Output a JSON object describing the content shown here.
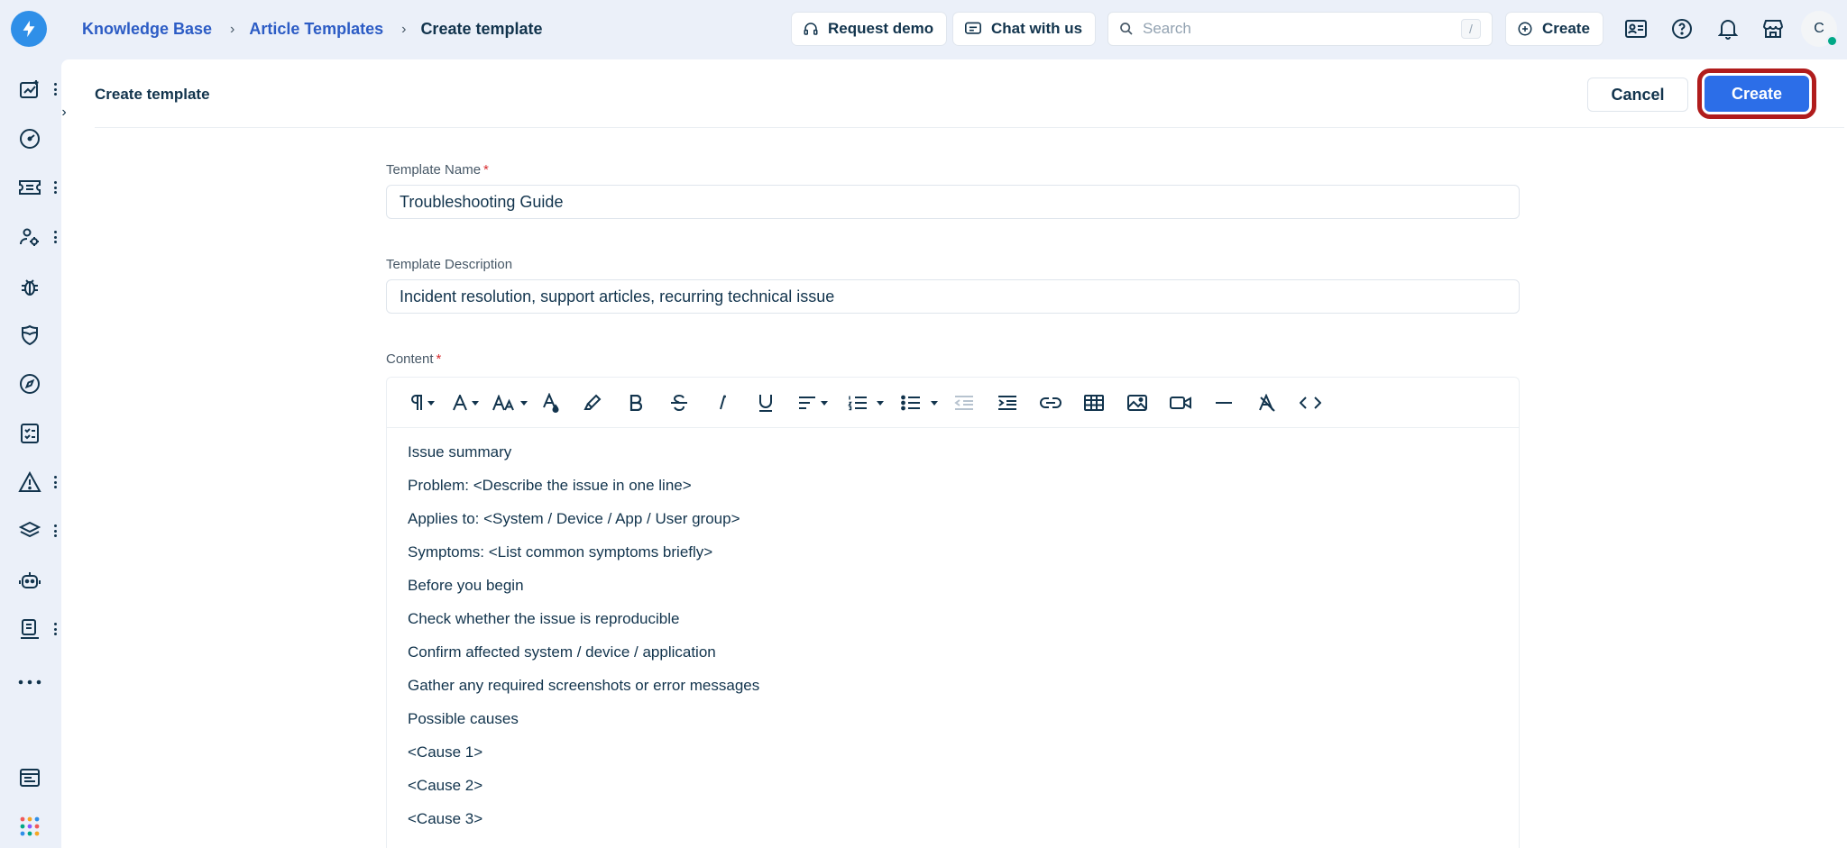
{
  "breadcrumb": {
    "items": [
      "Knowledge Base",
      "Article Templates"
    ],
    "current": "Create template"
  },
  "topbar": {
    "request_demo": "Request demo",
    "chat_with_us": "Chat with us",
    "search_placeholder": "Search",
    "search_shortcut": "/",
    "create_label": "Create",
    "avatar_initial": "C"
  },
  "page": {
    "title": "Create template",
    "cancel_label": "Cancel",
    "create_label": "Create"
  },
  "form": {
    "name_label": "Template Name",
    "name_value": "Troubleshooting Guide",
    "description_label": "Template Description",
    "description_value": "Incident resolution, support articles, recurring technical issue",
    "content_label": "Content",
    "required_marker": "*"
  },
  "editor": {
    "lines": [
      "Issue summary",
      "Problem: <Describe the issue in one line>",
      "Applies to: <System / Device / App / User group>",
      "Symptoms: <List common symptoms briefly>",
      "Before you begin",
      "Check whether the issue is reproducible",
      "Confirm affected system / device / application",
      "Gather any required screenshots or error messages",
      "Possible causes",
      "<Cause 1>",
      "<Cause 2>",
      "<Cause 3>"
    ]
  },
  "colors": {
    "primary": "#2c6ee8",
    "highlight_ring": "#b01c1c",
    "app_background": "#ebf0f9",
    "status_online": "#00a886"
  }
}
